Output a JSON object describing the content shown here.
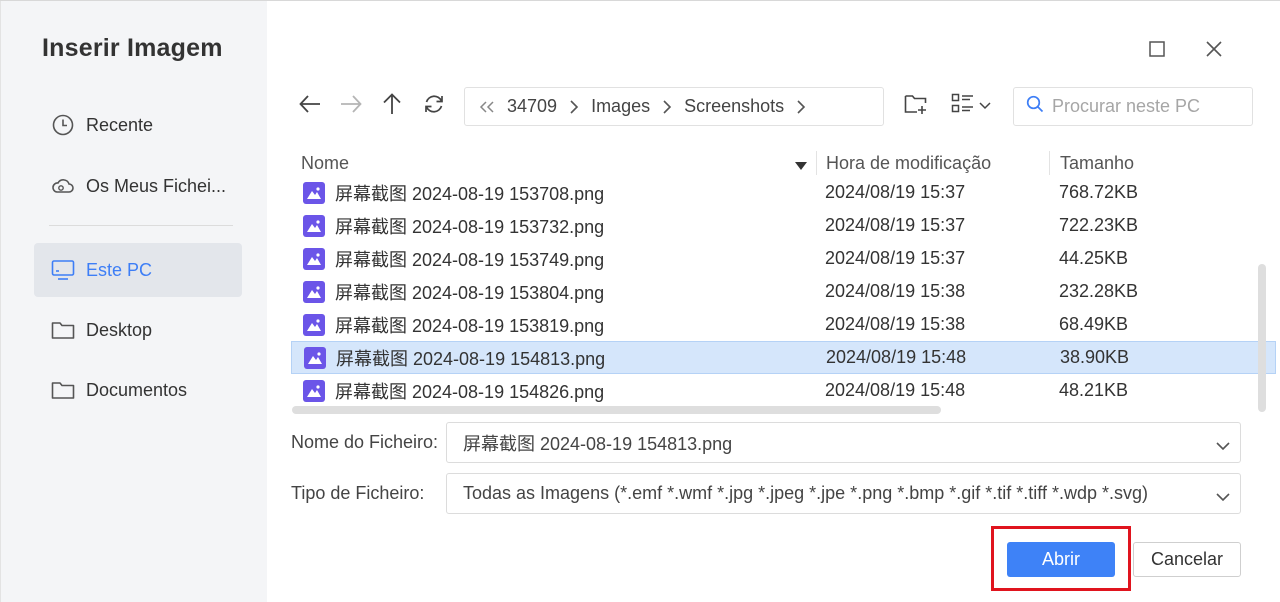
{
  "dialog": {
    "title": "Inserir Imagem"
  },
  "sidebar": {
    "items": [
      {
        "label": "Recente",
        "icon": "clock-icon"
      },
      {
        "label": "Os Meus Fichei...",
        "icon": "cloud-icon"
      },
      {
        "label": "Este PC",
        "icon": "monitor-icon",
        "active": true
      },
      {
        "label": "Desktop",
        "icon": "folder-icon"
      },
      {
        "label": "Documentos",
        "icon": "folder-icon"
      }
    ]
  },
  "breadcrumb": {
    "items": [
      "34709",
      "Images",
      "Screenshots"
    ]
  },
  "search": {
    "placeholder": "Procurar neste PC"
  },
  "columns": {
    "name": "Nome",
    "modified": "Hora de modificação",
    "size": "Tamanho"
  },
  "files": [
    {
      "name": "屏幕截图 2024-08-19 153708.png",
      "modified": "2024/08/19 15:37",
      "size": "768.72KB"
    },
    {
      "name": "屏幕截图 2024-08-19 153732.png",
      "modified": "2024/08/19 15:37",
      "size": "722.23KB"
    },
    {
      "name": "屏幕截图 2024-08-19 153749.png",
      "modified": "2024/08/19 15:37",
      "size": "44.25KB"
    },
    {
      "name": "屏幕截图 2024-08-19 153804.png",
      "modified": "2024/08/19 15:38",
      "size": "232.28KB"
    },
    {
      "name": "屏幕截图 2024-08-19 153819.png",
      "modified": "2024/08/19 15:38",
      "size": "68.49KB"
    },
    {
      "name": "屏幕截图 2024-08-19 154813.png",
      "modified": "2024/08/19 15:48",
      "size": "38.90KB",
      "selected": true
    },
    {
      "name": "屏幕截图 2024-08-19 154826.png",
      "modified": "2024/08/19 15:48",
      "size": "48.21KB"
    }
  ],
  "form": {
    "filename_label": "Nome do Ficheiro:",
    "filename_value": "屏幕截图 2024-08-19 154813.png",
    "filetype_label": "Tipo de Ficheiro:",
    "filetype_value": "Todas as Imagens (*.emf *.wmf *.jpg *.jpeg *.jpe *.png *.bmp *.gif *.tif *.tiff *.wdp *.svg)"
  },
  "buttons": {
    "open": "Abrir",
    "cancel": "Cancelar"
  },
  "colors": {
    "accent": "#3e82f7",
    "selection": "#d5e6fb",
    "highlight": "#e0141e",
    "file_icon": "#6b55e8"
  }
}
